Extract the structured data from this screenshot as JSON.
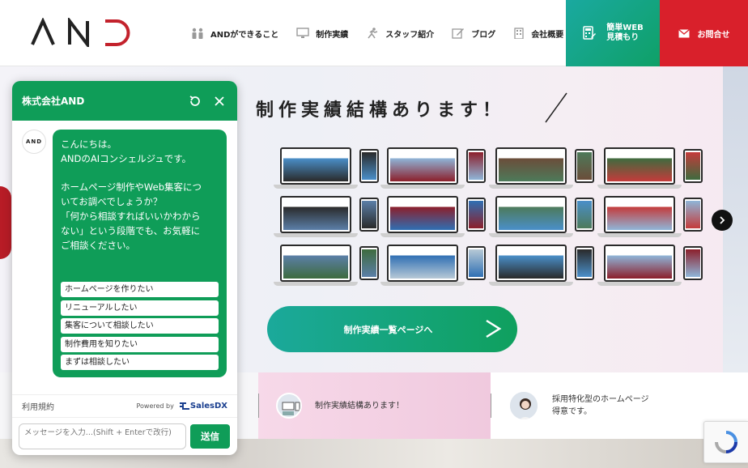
{
  "header": {
    "logo_text": "AND",
    "nav": [
      {
        "label": "ANDができること",
        "icon": "people-icon"
      },
      {
        "label": "制作実績",
        "icon": "monitor-icon"
      },
      {
        "label": "スタッフ紹介",
        "icon": "running-person-icon"
      },
      {
        "label": "ブログ",
        "icon": "pencil-note-icon"
      },
      {
        "label": "会社概要",
        "icon": "building-icon"
      }
    ],
    "quote_line1": "簡単WEB",
    "quote_line2": "見積もり",
    "contact_label": "お問合せ"
  },
  "hero": {
    "title": "制作実績結構あります！",
    "works_button": "制作実績一覧ページへ"
  },
  "band": {
    "item1": "制作実績結構あります！",
    "item2_line1": "採用特化型のホームページ",
    "item2_line2": "得意です。"
  },
  "chat": {
    "title": "株式会社AND",
    "avatar_text": "AND",
    "message": "こんにちは。\nANDのAIコンシェルジュです。\n\nホームページ制作やWeb集客につ\nいてお調べでしょうか？\n「何から相談すればいいかわから\nない」という段階でも、お気軽に\nご相談ください。",
    "options": [
      "ホームページを作りたい",
      "リニューアルしたい",
      "集客について相談したい",
      "制作費用を知りたい",
      "まずは相談したい"
    ],
    "terms": "利用規約",
    "powered_by": "Powered by",
    "brand": "SalesDX",
    "input_placeholder": "メッセージを入力...(Shift + Enterで改行)",
    "send_label": "送信"
  },
  "colors": {
    "green": "#0f9d58",
    "red": "#d9202b",
    "teal": "#1aa9a0"
  }
}
